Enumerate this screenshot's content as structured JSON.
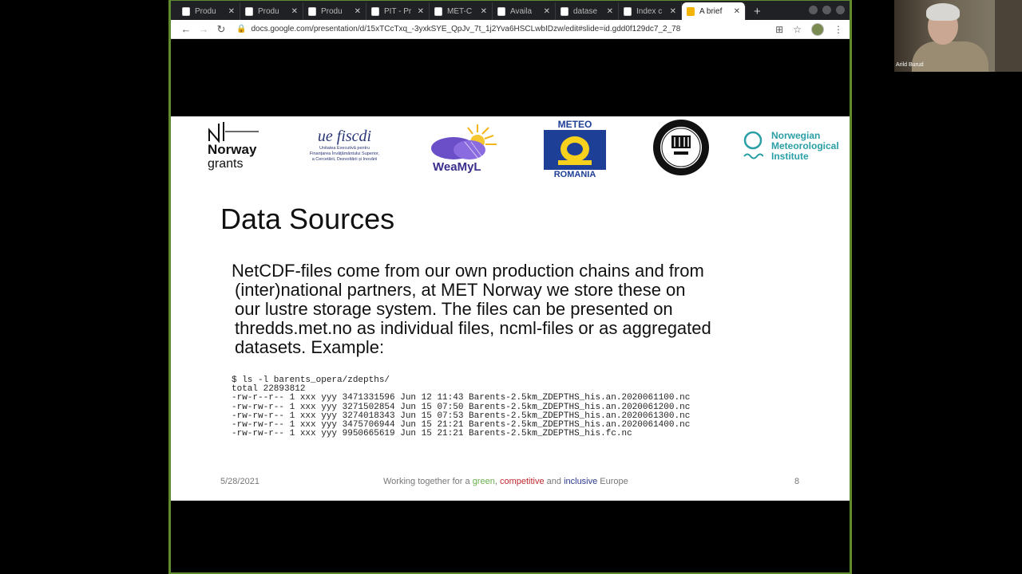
{
  "browser": {
    "tabs": [
      {
        "title": "Produ"
      },
      {
        "title": "Produ"
      },
      {
        "title": "Produ"
      },
      {
        "title": "PIT - Pr"
      },
      {
        "title": "MET-C"
      },
      {
        "title": "Availa"
      },
      {
        "title": "datase"
      },
      {
        "title": "Index c"
      },
      {
        "title": "A brief",
        "active": true
      }
    ],
    "url": "docs.google.com/presentation/d/15xTCcTxq_-3yxkSYE_QpJv_7t_1j2Yva6HSCLwbIDzw/edit#slide=id.gdd0f129dc7_2_78"
  },
  "slide": {
    "logos": {
      "norway_name": "Norway",
      "norway_sub": "grants",
      "uefiscdi_script": "ue fiscdi",
      "uefiscdi_line1": "Unitatea Executivă pentru",
      "uefiscdi_line2": "Finanțarea Învățământului Superior,",
      "uefiscdi_line3": "a Cercetării, Dezvoltării și Inovării",
      "weamyl": "WeaMyL",
      "meteo_top": "METEO",
      "meteo_bottom": "ROMANIA",
      "metno_line1": "Norwegian",
      "metno_line2": "Meteorological",
      "metno_line3": "Institute"
    },
    "title": "Data Sources",
    "body": {
      "line1": "NetCDF-files come from our own production chains and from",
      "line2": "(inter)national partners, at MET Norway we store these on",
      "line3": "our lustre storage system. The files can be presented on",
      "line4": "thredds.met.no as individual files, ncml-files or as aggregated",
      "line5": "datasets. Example:"
    },
    "code": [
      "$ ls -l barents_opera/zdepths/",
      "total 22893812",
      "-rw-r--r-- 1 xxx yyy 3471331596 Jun 12 11:43 Barents-2.5km_ZDEPTHS_his.an.2020061100.nc",
      "-rw-rw-r-- 1 xxx yyy 3271502854 Jun 15 07:50 Barents-2.5km_ZDEPTHS_his.an.2020061200.nc",
      "-rw-rw-r-- 1 xxx yyy 3274018343 Jun 15 07:53 Barents-2.5km_ZDEPTHS_his.an.2020061300.nc",
      "-rw-rw-r-- 1 xxx yyy 3475706944 Jun 15 21:21 Barents-2.5km_ZDEPTHS_his.an.2020061400.nc",
      "-rw-rw-r-- 1 xxx yyy 9950665619 Jun 15 21:21 Barents-2.5km_ZDEPTHS_his.fc.nc"
    ],
    "footer": {
      "date": "5/28/2021",
      "prefix": "Working together for a ",
      "green": "green",
      "sep1": ", ",
      "competitive": "competitive",
      "and": " and ",
      "inclusive": "inclusive",
      "suffix": " Europe",
      "page": "8"
    }
  },
  "webcam": {
    "name": "Arild Burud"
  },
  "colors": {
    "frame": "#5f8a2e",
    "green": "#6ab04c",
    "red": "#c0262c",
    "blue": "#2b3a8c",
    "metno": "#2a9fa6"
  }
}
